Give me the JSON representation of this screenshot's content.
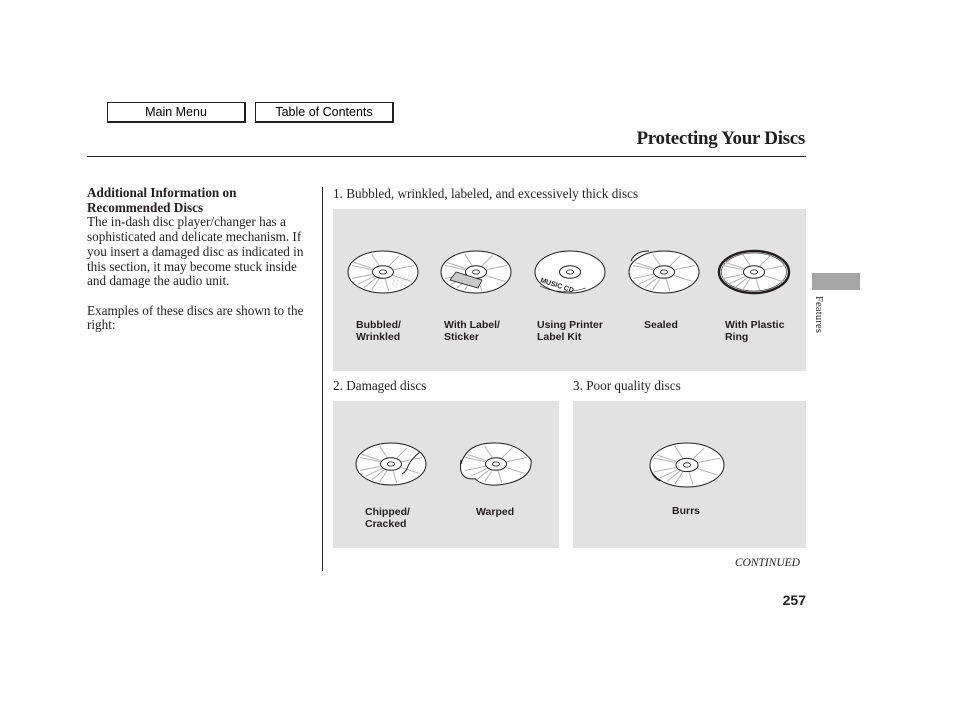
{
  "nav": {
    "main_menu": "Main Menu",
    "table_of_contents": "Table of Contents"
  },
  "header": {
    "title": "Protecting Your Discs"
  },
  "left_column": {
    "heading": "Additional Information on Recommended Discs",
    "paragraphs": [
      "The in-dash disc player/changer has a sophisticated and delicate mechanism. If you insert a damaged disc as indicated in this section, it may become stuck inside and damage the audio unit.",
      "Examples of these discs are shown to the right:"
    ]
  },
  "sections": [
    {
      "heading": "1. Bubbled, wrinkled, labeled, and excessively thick discs",
      "items": [
        {
          "label_line1": "Bubbled/",
          "label_line2": "Wrinkled",
          "icon": "bubbled-disc"
        },
        {
          "label_line1": "With Label/",
          "label_line2": "Sticker",
          "icon": "labeled-disc"
        },
        {
          "label_line1": "Using Printer",
          "label_line2": "Label Kit",
          "icon": "printer-label-disc",
          "disc_text": "MUSIC CD"
        },
        {
          "label_line1": "Sealed",
          "label_line2": "",
          "icon": "sealed-disc"
        },
        {
          "label_line1": "With Plastic",
          "label_line2": "Ring",
          "icon": "plastic-ring-disc"
        }
      ]
    },
    {
      "heading": "2. Damaged discs",
      "items": [
        {
          "label_line1": "Chipped/",
          "label_line2": "Cracked",
          "icon": "chipped-disc"
        },
        {
          "label_line1": "Warped",
          "label_line2": "",
          "icon": "warped-disc"
        }
      ]
    },
    {
      "heading": "3. Poor quality discs",
      "items": [
        {
          "label_line1": "Burrs",
          "label_line2": "",
          "icon": "burrs-disc"
        }
      ]
    }
  ],
  "footer": {
    "continued": "CONTINUED",
    "page_number": "257"
  },
  "side_tab": {
    "label": "Features"
  },
  "colors": {
    "panel_bg": "#e2e2e2",
    "side_tab": "#a6a6a6",
    "text": "#231f20"
  }
}
